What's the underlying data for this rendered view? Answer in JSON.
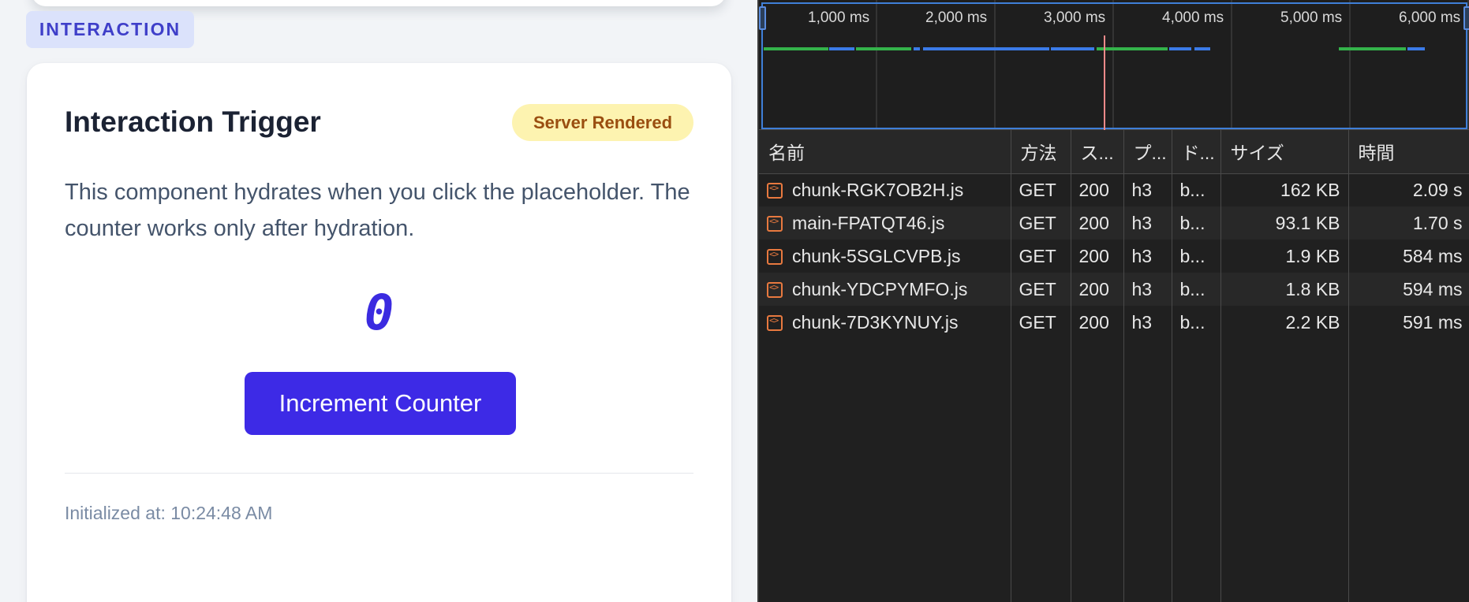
{
  "left": {
    "section_label": "INTERACTION",
    "card": {
      "title": "Interaction Trigger",
      "badge": "Server Rendered",
      "description": "This component hydrates when you click the placeholder. The counter works only after hydration.",
      "counter_value": "0",
      "button_label": "Increment Counter",
      "initialized_text": "Initialized at: 10:24:48 AM"
    }
  },
  "devtools": {
    "timeline": {
      "ticks": [
        "1,000 ms",
        "2,000 ms",
        "3,000 ms",
        "4,000 ms",
        "5,000 ms",
        "6,000 ms"
      ]
    },
    "columns": [
      "名前",
      "方法",
      "ス...",
      "プ...",
      "ド...",
      "サイズ",
      "時間"
    ],
    "rows": [
      {
        "name": "chunk-RGK7OB2H.js",
        "method": "GET",
        "status": "200",
        "protocol": "h3",
        "domain": "b...",
        "size": "162 KB",
        "time": "2.09 s"
      },
      {
        "name": "main-FPATQT46.js",
        "method": "GET",
        "status": "200",
        "protocol": "h3",
        "domain": "b...",
        "size": "93.1 KB",
        "time": "1.70 s"
      },
      {
        "name": "chunk-5SGLCVPB.js",
        "method": "GET",
        "status": "200",
        "protocol": "h3",
        "domain": "b...",
        "size": "1.9 KB",
        "time": "584 ms"
      },
      {
        "name": "chunk-YDCPYMFO.js",
        "method": "GET",
        "status": "200",
        "protocol": "h3",
        "domain": "b...",
        "size": "1.8 KB",
        "time": "594 ms"
      },
      {
        "name": "chunk-7D3KYNUY.js",
        "method": "GET",
        "status": "200",
        "protocol": "h3",
        "domain": "b...",
        "size": "2.2 KB",
        "time": "591 ms"
      }
    ],
    "colors": {
      "waiting": "#34b34a",
      "download": "#3b7be8",
      "marker": "#f08a8a"
    },
    "file_icon": "code-file-icon"
  }
}
